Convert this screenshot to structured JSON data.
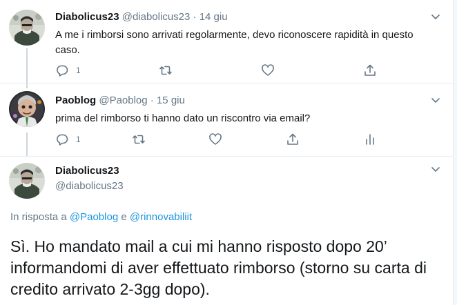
{
  "tweets": [
    {
      "name": "Diabolicus23",
      "handle": "@diabolicus23",
      "sep": "·",
      "date": "14 giu",
      "text": "A me i rimborsi sono arrivati regolarmente, devo riconoscere rapidità in questo caso.",
      "reply_count": "1"
    },
    {
      "name": "Paoblog",
      "handle": "@Paoblog",
      "sep": "·",
      "date": "15 giu",
      "text": "prima del rimborso ti hanno dato un riscontro via email?",
      "reply_count": "1"
    }
  ],
  "main_tweet": {
    "name": "Diabolicus23",
    "handle": "@diabolicus23",
    "reply_prefix": "In risposta a",
    "reply_user_1": "@Paoblog",
    "reply_conj": "e",
    "reply_user_2": "@rinnovabiliit",
    "text": "Sì. Ho mandato mail a cui mi hanno risposto dopo 20’ informandomi di aver effettuato rimborso (storno su carta di credito arrivato 2-3gg dopo)."
  },
  "icons": {
    "reply": "reply-icon",
    "retweet": "retweet-icon",
    "like": "like-icon",
    "share": "share-icon",
    "analytics": "analytics-icon",
    "menu": "chevron-down-icon"
  },
  "colors": {
    "text": "#14171a",
    "muted": "#657786",
    "link": "#1b95e0",
    "divider": "#e6ecf0",
    "thread_line": "#ccd6dd"
  }
}
